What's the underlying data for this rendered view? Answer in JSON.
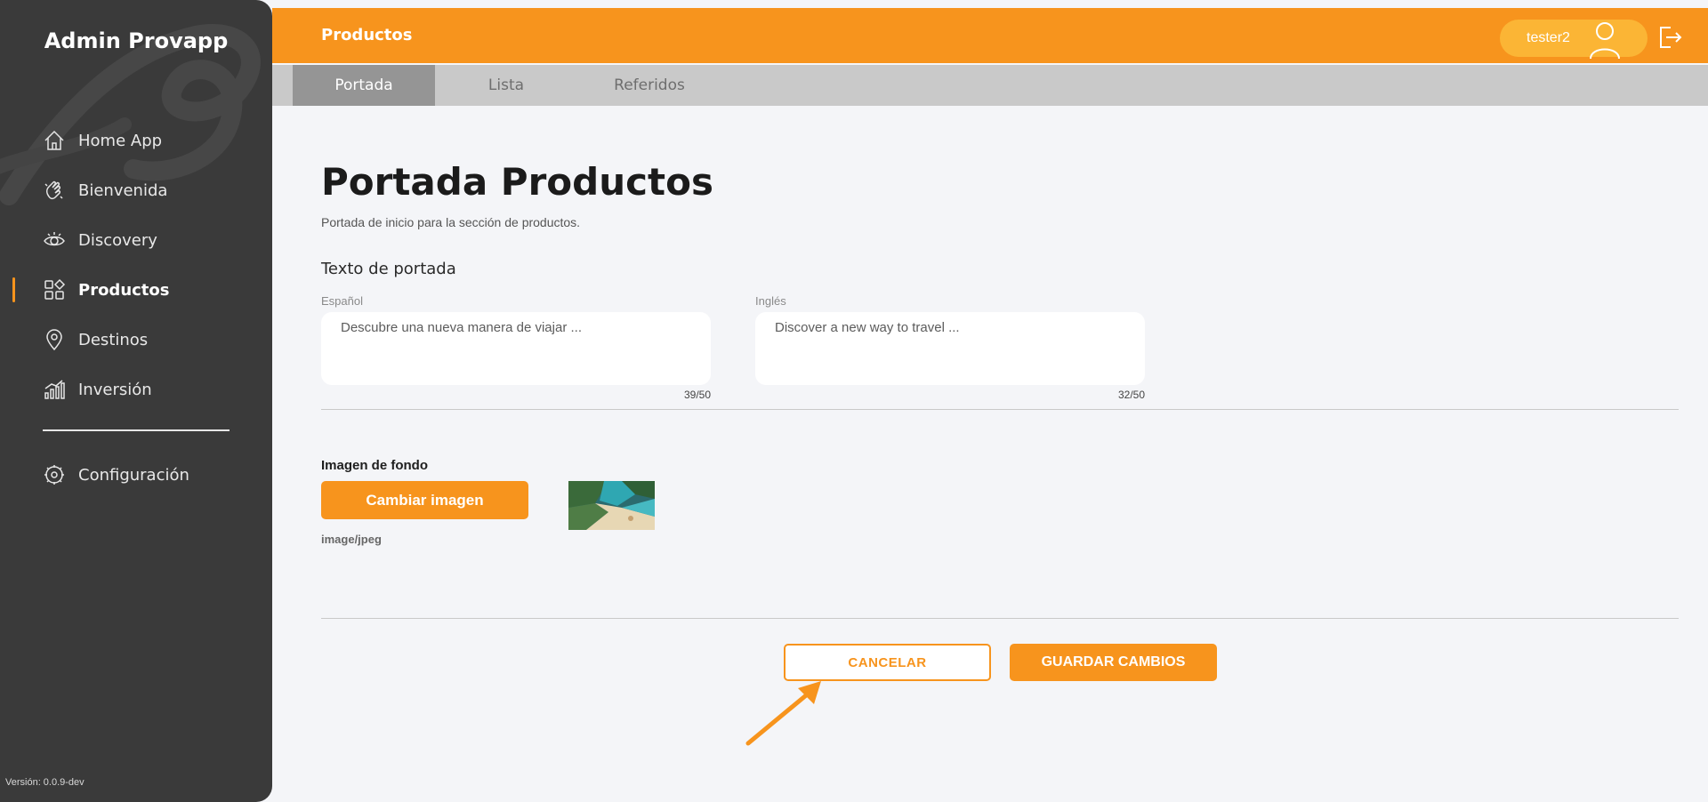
{
  "app": {
    "brand": "Admin Provapp",
    "version": "Versión: 0.0.9-dev"
  },
  "sidebar": {
    "items": [
      {
        "label": "Home App",
        "icon": "home-icon"
      },
      {
        "label": "Bienvenida",
        "icon": "waving-hand-icon"
      },
      {
        "label": "Discovery",
        "icon": "eye-icon"
      },
      {
        "label": "Productos",
        "icon": "grid-shapes-icon",
        "active": true
      },
      {
        "label": "Destinos",
        "icon": "map-pin-icon"
      },
      {
        "label": "Inversión",
        "icon": "bar-chart-icon"
      }
    ],
    "config": {
      "label": "Configuración",
      "icon": "gear-icon"
    }
  },
  "header": {
    "title": "Productos",
    "user": "tester2",
    "user_icon": "user-avatar-icon",
    "logout_icon": "logout-icon"
  },
  "tabs": [
    {
      "label": "Portada",
      "active": true
    },
    {
      "label": "Lista"
    },
    {
      "label": "Referidos"
    }
  ],
  "main": {
    "title": "Portada Productos",
    "subtitle": "Portada de inicio para la sección de productos.",
    "section_title": "Texto de portada",
    "fields": [
      {
        "label": "Español",
        "value": "Descubre una nueva manera de viajar ...",
        "counter": "39/50"
      },
      {
        "label": "Inglés",
        "value": "Discover a new way to travel ...",
        "counter": "32/50"
      }
    ],
    "image": {
      "label": "Imagen de fondo",
      "button": "Cambiar imagen",
      "mime": "image/jpeg"
    },
    "actions": {
      "cancel": "CANCELAR",
      "save": "GUARDAR CAMBIOS"
    }
  },
  "colors": {
    "accent": "#f7941d",
    "sidebar": "#3a3a3a",
    "tabbar": "#c9c9c9",
    "tab_active": "#959595"
  }
}
